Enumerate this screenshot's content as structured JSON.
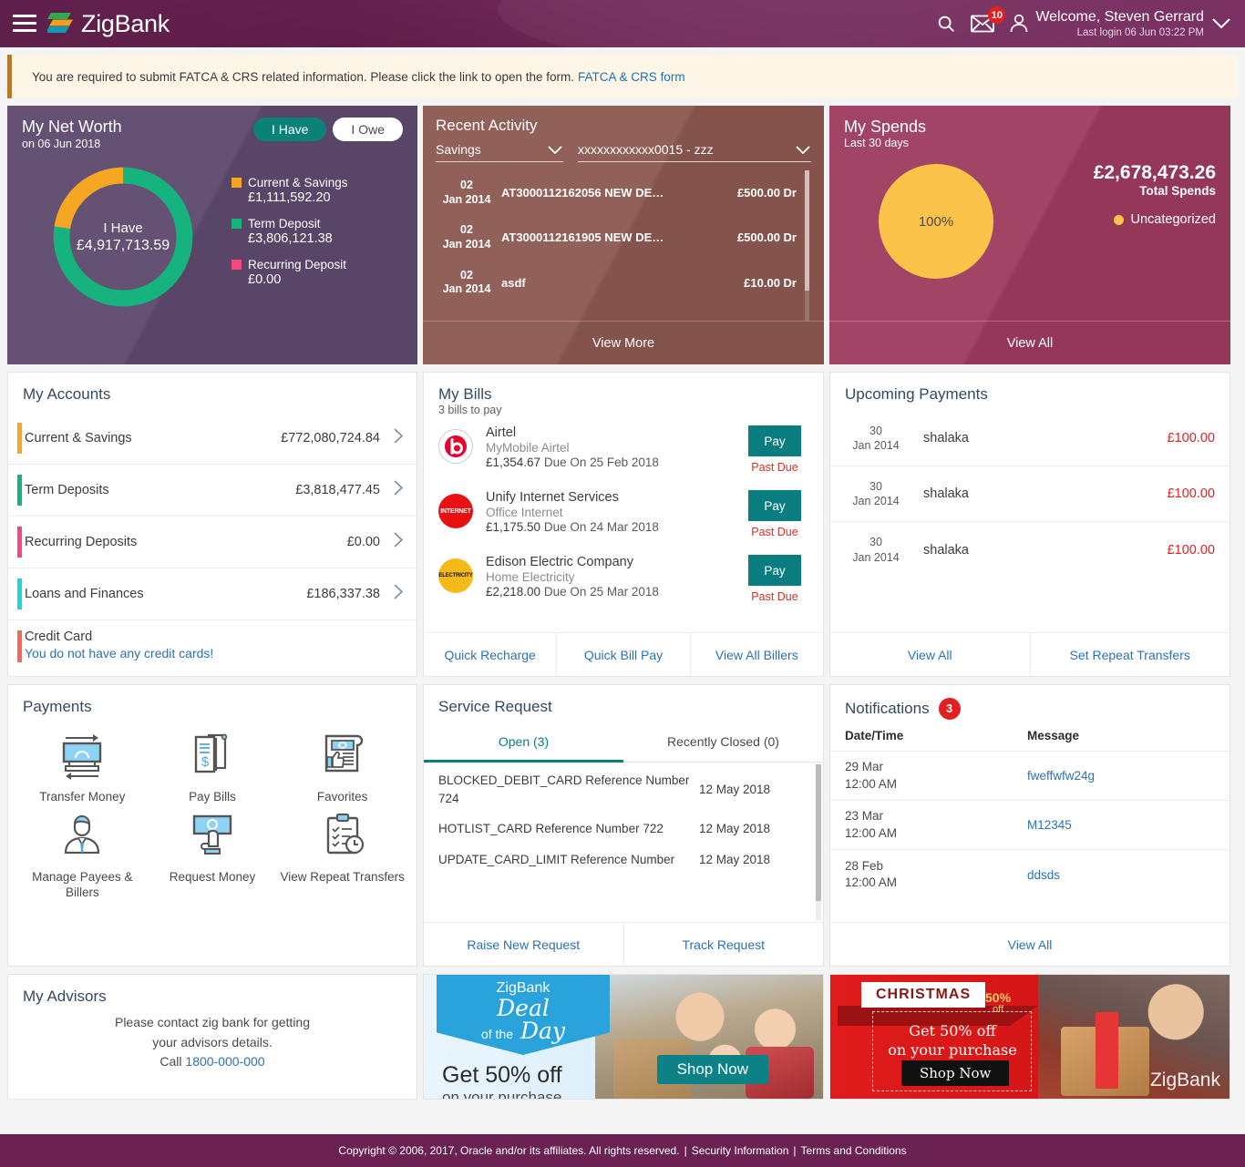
{
  "header": {
    "brand": "ZigBank",
    "menu_icon": "hamburger-icon",
    "search_icon": "search-icon",
    "mail_icon": "mail-icon",
    "mail_badge": "10",
    "user_icon": "user-icon",
    "welcome": "Welcome, Steven Gerrard",
    "last_login": "Last login 06 Jun 03:22 PM",
    "chevron_icon": "chevron-down-icon",
    "bg_color": "#6b2252"
  },
  "fatca": {
    "message": "You are required to submit FATCA & CRS related information. Please click the link to open the form.",
    "link": "FATCA & CRS form"
  },
  "net_worth": {
    "title": "My Net Worth",
    "date": "on 06 Jun 2018",
    "toggle_have": "I Have",
    "toggle_owe": "I Owe",
    "center_label": "I Have",
    "center_amount": "£4,917,713.59",
    "bg_color": "#5c486d"
  },
  "recent_activity": {
    "title": "Recent Activity",
    "account_type": "Savings",
    "account_number": "xxxxxxxxxxxx0015 - zzz",
    "view_more": "View More",
    "bg_color": "#8a5750",
    "rows": [
      {
        "day": "02",
        "month": "Jan 2014",
        "description": "AT3000112162056 NEW DE…",
        "amount": "£500.00 Dr"
      },
      {
        "day": "02",
        "month": "Jan 2014",
        "description": "AT3000112161905 NEW DE…",
        "amount": "£500.00 Dr"
      },
      {
        "day": "02",
        "month": "Jan 2014",
        "description": "asdf",
        "amount": "£10.00 Dr"
      }
    ]
  },
  "spends": {
    "title": "My Spends",
    "subtitle": "Last 30 days",
    "total": "£2,678,473.26",
    "total_label": "Total Spends",
    "legend_label": "Uncategorized",
    "slice_label": "100%",
    "view_all": "View All",
    "bg_color": "#9c3a5e"
  },
  "accounts": {
    "title": "My Accounts",
    "rows": [
      {
        "name": "Current & Savings",
        "amount": "£772,080,724.84",
        "color": "#f5a623"
      },
      {
        "name": "Term Deposits",
        "amount": "£3,818,477.45",
        "color": "#17b37f"
      },
      {
        "name": "Recurring Deposits",
        "amount": "£0.00",
        "color": "#f5497e"
      },
      {
        "name": "Loans and Finances",
        "amount": "£186,337.38",
        "color": "#1fd6e0"
      }
    ],
    "credit_card_label": "Credit Card",
    "credit_card_message": "You do not have any credit cards!",
    "credit_card_color": "#f4685c"
  },
  "bills": {
    "title": "My Bills",
    "subtitle": "3 bills to pay",
    "pay_label": "Pay",
    "past_due_label": "Past Due",
    "rows": [
      {
        "icon": "beats-logo-icon",
        "name": "Airtel",
        "plan": "MyMobile Airtel",
        "amount": "£1,354.67",
        "due": "Due On 25 Feb 2018"
      },
      {
        "icon": "internet-logo-icon",
        "name": "Unify Internet Services",
        "plan": "Office Internet",
        "amount": "£1,175.50",
        "due": "Due On 24 Mar 2018"
      },
      {
        "icon": "electricity-logo-icon",
        "name": "Edison Electric Company",
        "plan": "Home Electricity",
        "amount": "£2,218.00",
        "due": "Due On 25 Mar 2018"
      }
    ],
    "footer_links": [
      "Quick Recharge",
      "Quick Bill Pay",
      "View All Billers"
    ]
  },
  "upcoming": {
    "title": "Upcoming Payments",
    "rows": [
      {
        "day": "30",
        "month": "Jan 2014",
        "payee": "shalaka",
        "amount": "£100.00"
      },
      {
        "day": "30",
        "month": "Jan 2014",
        "payee": "shalaka",
        "amount": "£100.00"
      },
      {
        "day": "30",
        "month": "Jan 2014",
        "payee": "shalaka",
        "amount": "£100.00"
      }
    ],
    "footer_links": [
      "View All",
      "Set Repeat Transfers"
    ]
  },
  "payments": {
    "title": "Payments",
    "items": [
      {
        "icon": "transfer-money-icon",
        "label": "Transfer Money"
      },
      {
        "icon": "pay-bills-icon",
        "label": "Pay Bills"
      },
      {
        "icon": "favorites-icon",
        "label": "Favorites"
      },
      {
        "icon": "manage-payees-icon",
        "label": "Manage Payees & Billers"
      },
      {
        "icon": "request-money-icon",
        "label": "Request Money"
      },
      {
        "icon": "view-repeat-transfers-icon",
        "label": "View Repeat Transfers"
      }
    ]
  },
  "service_request": {
    "title": "Service Request",
    "tab_open": "Open (3)",
    "tab_closed": "Recently Closed (0)",
    "rows": [
      {
        "name": "BLOCKED_DEBIT_CARD Reference Number 724",
        "date": "12 May 2018"
      },
      {
        "name": "HOTLIST_CARD Reference Number 722",
        "date": "12 May 2018"
      },
      {
        "name": "UPDATE_CARD_LIMIT Reference Number",
        "date": "12 May 2018"
      }
    ],
    "footer_links": [
      "Raise New Request",
      "Track Request"
    ]
  },
  "notifications": {
    "title": "Notifications",
    "badge": "3",
    "col_datetime": "Date/Time",
    "col_message": "Message",
    "rows": [
      {
        "date": "29 Mar",
        "time": "12:00 AM",
        "message": "fweffwfw24g"
      },
      {
        "date": "23 Mar",
        "time": "12:00 AM",
        "message": "M12345"
      },
      {
        "date": "28 Feb",
        "time": "12:00 AM",
        "message": "ddsds"
      }
    ],
    "view_all": "View All"
  },
  "advisors": {
    "title": "My Advisors",
    "line1": "Please contact zig bank for getting",
    "line2": "your advisors details.",
    "call_label": "Call",
    "phone": "1800-000-000"
  },
  "promo_deal": {
    "brand": "ZigBank",
    "script_line1": "Deal",
    "script_line2": "of the",
    "script_line3": "Day",
    "offer_big": "Get 50% off",
    "offer_small": "on your purchase",
    "cta": "Shop Now"
  },
  "promo_xmas": {
    "tag": "CHRISTMAS",
    "percent": "50%",
    "off": "off",
    "line1": "Get 50% off",
    "line2": "on your purchase",
    "cta": "Shop Now",
    "watermark": "ZigBank"
  },
  "footer": {
    "copyright": "Copyright © 2006, 2017, Oracle and/or its affiliates. All rights reserved.",
    "security": "Security Information",
    "terms": "Terms and Conditions"
  },
  "chart_data": [
    {
      "type": "pie",
      "title": "My Net Worth",
      "subtitle": "on 06 Jun 2018",
      "categories": [
        "Current & Savings",
        "Term Deposit",
        "Recurring Deposit"
      ],
      "values": [
        1111592.2,
        3806121.38,
        0.0
      ],
      "value_labels": [
        "£1,111,592.20",
        "£3,806,121.38",
        "£0.00"
      ],
      "percentages": [
        22.6,
        77.4,
        0.0
      ],
      "colors": [
        "#f5a623",
        "#17b37f",
        "#f5497e"
      ],
      "total": 4917713.59,
      "total_label": "£4,917,713.59",
      "center_text": "I Have",
      "donut": true,
      "legend_position": "right"
    },
    {
      "type": "pie",
      "title": "My Spends",
      "subtitle": "Last 30 days",
      "categories": [
        "Uncategorized"
      ],
      "values": [
        2678473.26
      ],
      "value_labels": [
        "£2,678,473.26"
      ],
      "percentages": [
        100
      ],
      "data_labels": [
        "100%"
      ],
      "colors": [
        "#fbc34a"
      ],
      "total": 2678473.26,
      "total_label": "£2,678,473.26",
      "donut": false,
      "legend_position": "right"
    }
  ]
}
